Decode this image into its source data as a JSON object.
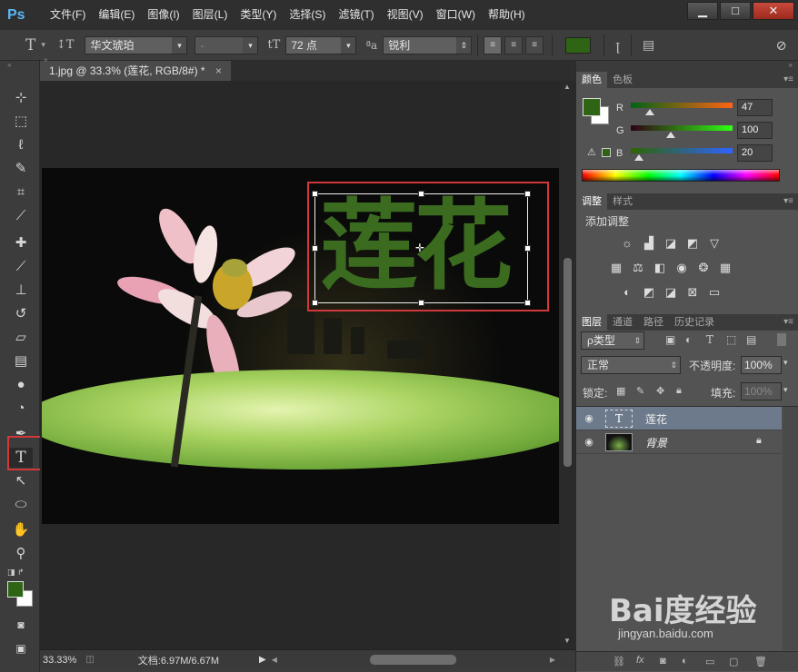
{
  "app": {
    "logo": "Ps"
  },
  "menu": [
    "文件(F)",
    "编辑(E)",
    "图像(I)",
    "图层(L)",
    "类型(Y)",
    "选择(S)",
    "滤镜(T)",
    "视图(V)",
    "窗口(W)",
    "帮助(H)"
  ],
  "window_controls": {
    "minimize": "▁",
    "maximize": "□",
    "close": "✕"
  },
  "options": {
    "tool_glyph": "T",
    "orient_glyph": "↕T",
    "font_family": "华文琥珀",
    "font_style": "-",
    "size_glyph": "tT",
    "font_size": "72 点",
    "aa_glyph": "ªa",
    "antialias": "锐利",
    "text_color": "#2f6414"
  },
  "document": {
    "tab_title": "1.jpg @ 33.3% (莲花, RGB/8#) *",
    "tab_close": "×",
    "text_layer_content": "莲花",
    "zoom": "33.33%",
    "doc_size": "文档:6.97M/6.67M"
  },
  "tools": [
    {
      "name": "move",
      "glyph": "⊹"
    },
    {
      "name": "marquee",
      "glyph": "⬚"
    },
    {
      "name": "lasso",
      "glyph": "ℓ"
    },
    {
      "name": "quick-select",
      "glyph": "✎"
    },
    {
      "name": "crop",
      "glyph": "⌗"
    },
    {
      "name": "eyedropper",
      "glyph": "⟋"
    },
    {
      "name": "healing",
      "glyph": "✚"
    },
    {
      "name": "brush",
      "glyph": "⟋"
    },
    {
      "name": "stamp",
      "glyph": "⊥"
    },
    {
      "name": "history-brush",
      "glyph": "↺"
    },
    {
      "name": "eraser",
      "glyph": "▱"
    },
    {
      "name": "gradient",
      "glyph": "▤"
    },
    {
      "name": "blur",
      "glyph": "●"
    },
    {
      "name": "dodge",
      "glyph": "◔"
    },
    {
      "name": "pen",
      "glyph": "✒"
    },
    {
      "name": "type",
      "glyph": "T"
    },
    {
      "name": "path-select",
      "glyph": "↖"
    },
    {
      "name": "ellipse",
      "glyph": "⬭"
    },
    {
      "name": "hand",
      "glyph": "✋"
    },
    {
      "name": "zoom",
      "glyph": "⚲"
    }
  ],
  "color_panel": {
    "tabs": [
      "颜色",
      "色板"
    ],
    "r": 47,
    "g": 100,
    "b": 20,
    "labels": [
      "R",
      "G",
      "B"
    ],
    "fg_color": "#2f6414"
  },
  "adjust_panel": {
    "tabs": [
      "调整",
      "样式"
    ],
    "title": "添加调整"
  },
  "layers_panel": {
    "tabs": [
      "图层",
      "通道",
      "路径",
      "历史记录"
    ],
    "kind_filter": "ρ类型",
    "blend_mode": "正常",
    "opacity_label": "不透明度:",
    "opacity_value": "100%",
    "lock_label": "锁定:",
    "fill_label": "填充:",
    "fill_value": "100%",
    "layers": [
      {
        "name": "莲花",
        "thumb": "T",
        "selected": true
      },
      {
        "name": "背景",
        "thumb": "",
        "selected": false
      }
    ]
  },
  "watermark": {
    "brand": "Bai度经验",
    "url": "jingyan.baidu.com"
  }
}
